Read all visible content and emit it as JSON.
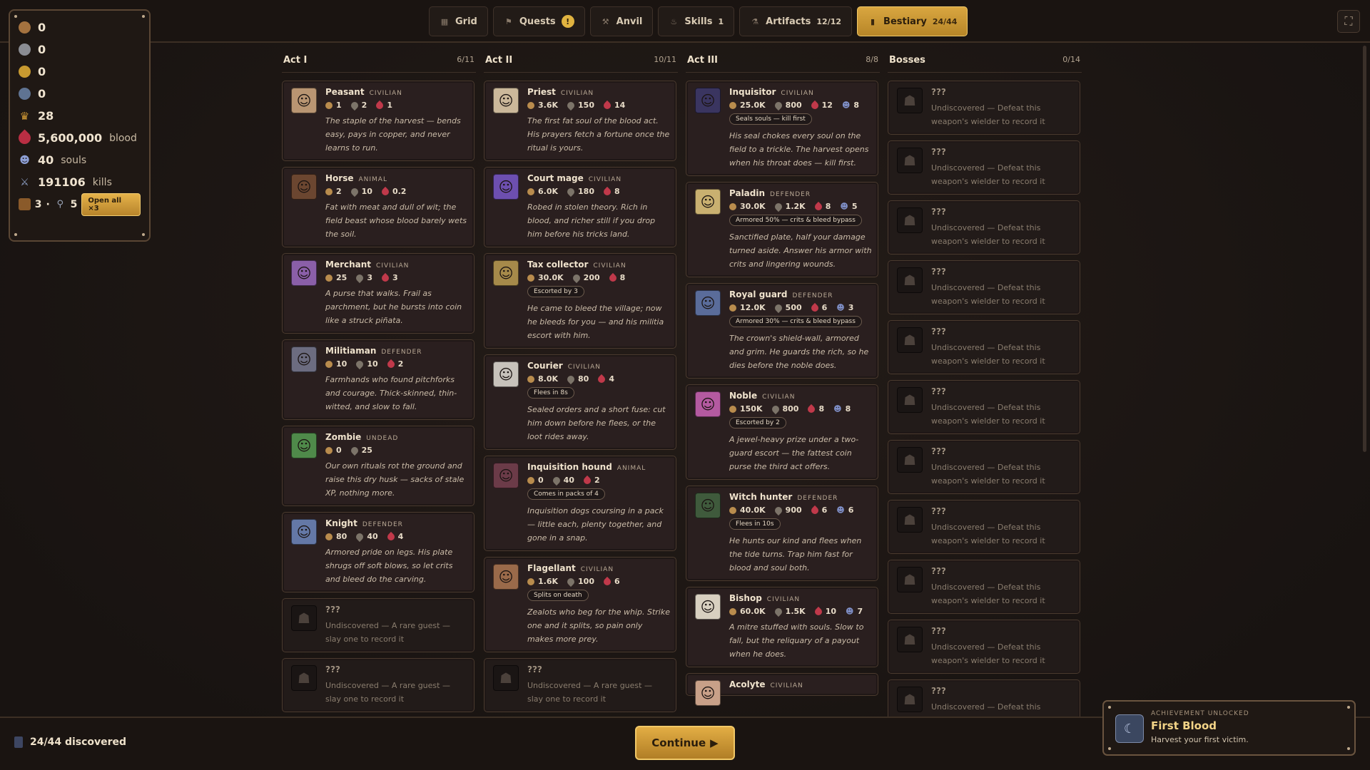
{
  "tabs": [
    {
      "label": "Grid",
      "count": "",
      "icon": "grid-icon"
    },
    {
      "label": "Quests",
      "count": "",
      "badge": "!",
      "icon": "banner-icon"
    },
    {
      "label": "Anvil",
      "count": "",
      "icon": "anvil-icon"
    },
    {
      "label": "Skills",
      "count": "1",
      "icon": "flame-icon"
    },
    {
      "label": "Artifacts",
      "count": "12/12",
      "icon": "flask-icon"
    },
    {
      "label": "Bestiary",
      "count": "24/44",
      "icon": "book-icon",
      "active": true
    }
  ],
  "resources": {
    "r1": "0",
    "r2": "0",
    "r3": "0",
    "r4": "0",
    "crowns": "28",
    "blood_value": "5,600,000",
    "blood_label": "blood",
    "souls_value": "40",
    "souls_label": "souls",
    "kills_value": "191106",
    "kills_label": "kills",
    "chests": "3",
    "keys": "5",
    "open_all": "Open all ×3"
  },
  "columns": [
    {
      "name": "Act I",
      "count": "6/11",
      "cards": [
        {
          "name": "Peasant",
          "type": "CIVILIAN",
          "coin": "1",
          "soul": "2",
          "blood": "1",
          "desc": "The staple of the harvest — bends easy, pays in copper, and never learns to run.",
          "color": "#b99572"
        },
        {
          "name": "Horse",
          "type": "ANIMAL",
          "coin": "2",
          "soul": "10",
          "blood": "0.2",
          "desc": "Fat with meat and dull of wit; the field beast whose blood barely wets the soil.",
          "color": "#6b4630"
        },
        {
          "name": "Merchant",
          "type": "CIVILIAN",
          "coin": "25",
          "soul": "3",
          "blood": "3",
          "desc": "A purse that walks. Frail as parchment, but he bursts into coin like a struck piñata.",
          "color": "#8a5fa8"
        },
        {
          "name": "Militiaman",
          "type": "DEFENDER",
          "coin": "10",
          "soul": "10",
          "blood": "2",
          "desc": "Farmhands who found pitchforks and courage. Thick-skinned, thin-witted, and slow to fall.",
          "color": "#6c6c80"
        },
        {
          "name": "Zombie",
          "type": "UNDEAD",
          "coin": "0",
          "soul": "25",
          "blood": "",
          "desc": "Our own rituals rot the ground and raise this dry husk — sacks of stale XP, nothing more.",
          "color": "#4f8a4a"
        },
        {
          "name": "Knight",
          "type": "DEFENDER",
          "coin": "80",
          "soul": "40",
          "blood": "4",
          "desc": "Armored pride on legs. His plate shrugs off soft blows, so let crits and bleed do the carving.",
          "color": "#6478a6"
        },
        {
          "name": "???",
          "type": "",
          "unknown": true,
          "desc": "Undiscovered — A rare guest — slay one to record it"
        },
        {
          "name": "???",
          "type": "",
          "unknown": true,
          "desc": "Undiscovered — A rare guest — slay one to record it"
        }
      ]
    },
    {
      "name": "Act II",
      "count": "10/11",
      "cards": [
        {
          "name": "Priest",
          "type": "CIVILIAN",
          "coin": "3.6K",
          "soul": "150",
          "blood": "14",
          "desc": "The first fat soul of the blood act. His prayers fetch a fortune once the ritual is yours.",
          "color": "#cbb89a"
        },
        {
          "name": "Court mage",
          "type": "CIVILIAN",
          "coin": "6.0K",
          "soul": "180",
          "blood": "8",
          "desc": "Robed in stolen theory. Rich in blood, and richer still if you drop him before his tricks land.",
          "color": "#6d4fb0"
        },
        {
          "name": "Tax collector",
          "type": "CIVILIAN",
          "coin": "30.0K",
          "soul": "200",
          "blood": "8",
          "chip": "Escorted by 3",
          "desc": "He came to bleed the village; now he bleeds for you — and his militia escort with him.",
          "color": "#a68a4a"
        },
        {
          "name": "Courier",
          "type": "CIVILIAN",
          "coin": "8.0K",
          "soul": "80",
          "blood": "4",
          "chip": "Flees in 8s",
          "desc": "Sealed orders and a short fuse: cut him down before he flees, or the loot rides away.",
          "color": "#c7c2bb"
        },
        {
          "name": "Inquisition hound",
          "type": "ANIMAL",
          "coin": "0",
          "soul": "40",
          "blood": "2",
          "chip": "Comes in packs of 4",
          "desc": "Inquisition dogs coursing in a pack — little each, plenty together, and gone in a snap.",
          "color": "#6b3b48"
        },
        {
          "name": "Flagellant",
          "type": "CIVILIAN",
          "coin": "1.6K",
          "soul": "100",
          "blood": "6",
          "chip": "Splits on death",
          "desc": "Zealots who beg for the whip. Strike one and it splits, so pain only makes more prey.",
          "color": "#9a6a4a"
        },
        {
          "name": "???",
          "type": "",
          "unknown": true,
          "desc": "Undiscovered — A rare guest — slay one to record it"
        }
      ]
    },
    {
      "name": "Act III",
      "count": "8/8",
      "cards": [
        {
          "name": "Inquisitor",
          "type": "CIVILIAN",
          "coin": "25.0K",
          "soul": "800",
          "blood": "12",
          "kill": "8",
          "chip": "Seals souls — kill first",
          "desc": "His seal chokes every soul on the field to a trickle. The harvest opens when his throat does — kill first.",
          "color": "#3a3560"
        },
        {
          "name": "Paladin",
          "type": "DEFENDER",
          "coin": "30.0K",
          "soul": "1.2K",
          "blood": "8",
          "kill": "5",
          "chip": "Armored 50% — crits & bleed bypass",
          "desc": "Sanctified plate, half your damage turned aside. Answer his armor with crits and lingering wounds.",
          "color": "#c9b070"
        },
        {
          "name": "Royal guard",
          "type": "DEFENDER",
          "coin": "12.0K",
          "soul": "500",
          "blood": "6",
          "kill": "3",
          "chip": "Armored 30% — crits & bleed bypass",
          "desc": "The crown's shield-wall, armored and grim. He guards the rich, so he dies before the noble does.",
          "color": "#5a6c9a"
        },
        {
          "name": "Noble",
          "type": "CIVILIAN",
          "coin": "150K",
          "soul": "800",
          "blood": "8",
          "kill": "8",
          "chip": "Escorted by 2",
          "desc": "A jewel-heavy prize under a two-guard escort — the fattest coin purse the third act offers.",
          "color": "#b45aa0"
        },
        {
          "name": "Witch hunter",
          "type": "DEFENDER",
          "coin": "40.0K",
          "soul": "900",
          "blood": "6",
          "kill": "6",
          "chip": "Flees in 10s",
          "desc": "He hunts our kind and flees when the tide turns. Trap him fast for blood and soul both.",
          "color": "#3f5a3c"
        },
        {
          "name": "Bishop",
          "type": "CIVILIAN",
          "coin": "60.0K",
          "soul": "1.5K",
          "blood": "10",
          "kill": "7",
          "desc": "A mitre stuffed with souls. Slow to fall, but the reliquary of a payout when he does.",
          "color": "#d8d0c0"
        },
        {
          "name": "Acolyte",
          "type": "CIVILIAN",
          "coin": "",
          "soul": "",
          "blood": "",
          "desc": "",
          "color": "#c8a088"
        }
      ]
    },
    {
      "name": "Bosses",
      "count": "0/14",
      "cards": [
        {
          "name": "???",
          "unknown": true,
          "desc": "Undiscovered — Defeat this weapon's wielder to record it"
        },
        {
          "name": "???",
          "unknown": true,
          "desc": "Undiscovered — Defeat this weapon's wielder to record it"
        },
        {
          "name": "???",
          "unknown": true,
          "desc": "Undiscovered — Defeat this weapon's wielder to record it"
        },
        {
          "name": "???",
          "unknown": true,
          "desc": "Undiscovered — Defeat this weapon's wielder to record it"
        },
        {
          "name": "???",
          "unknown": true,
          "desc": "Undiscovered — Defeat this weapon's wielder to record it"
        },
        {
          "name": "???",
          "unknown": true,
          "desc": "Undiscovered — Defeat this weapon's wielder to record it"
        },
        {
          "name": "???",
          "unknown": true,
          "desc": "Undiscovered — Defeat this weapon's wielder to record it"
        },
        {
          "name": "???",
          "unknown": true,
          "desc": "Undiscovered — Defeat this weapon's wielder to record it"
        },
        {
          "name": "???",
          "unknown": true,
          "desc": "Undiscovered — Defeat this weapon's wielder to record it"
        },
        {
          "name": "???",
          "unknown": true,
          "desc": "Undiscovered — Defeat this weapon's wielder to record it"
        },
        {
          "name": "???",
          "unknown": true,
          "desc": "Undiscovered — Defeat this weapon's wielder to record it"
        }
      ]
    }
  ],
  "footer": {
    "discovered": "24/44 discovered",
    "continue": "Continue"
  },
  "achievement": {
    "label": "ACHIEVEMENT UNLOCKED",
    "title": "First Blood",
    "desc": "Harvest your first victim."
  }
}
